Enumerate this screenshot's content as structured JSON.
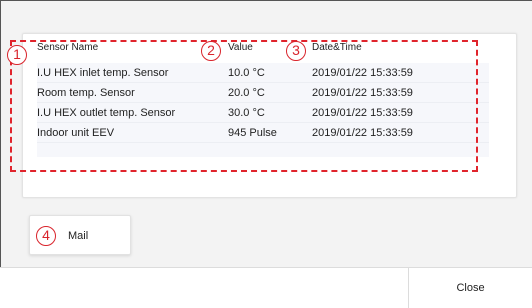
{
  "table": {
    "headers": {
      "name": "Sensor Name",
      "value": "Value",
      "time": "Date&Time"
    },
    "rows": [
      {
        "name": "I.U HEX inlet temp. Sensor",
        "value": "10.0 °C",
        "time": "2019/01/22 15:33:59"
      },
      {
        "name": "Room temp. Sensor",
        "value": "20.0 °C",
        "time": "2019/01/22 15:33:59"
      },
      {
        "name": "I.U HEX outlet temp. Sensor",
        "value": "30.0 °C",
        "time": "2019/01/22 15:33:59"
      },
      {
        "name": "Indoor unit EEV",
        "value": "945 Pulse",
        "time": "2019/01/22 15:33:59"
      }
    ]
  },
  "markers": {
    "m1": "1",
    "m2": "2",
    "m3": "3",
    "m4": "4"
  },
  "buttons": {
    "mail": "Mail",
    "close": "Close"
  },
  "colors": {
    "annotation_red": "#e0242c",
    "row_background": "#f6f7fb",
    "page_background": "#f3f3f3"
  }
}
